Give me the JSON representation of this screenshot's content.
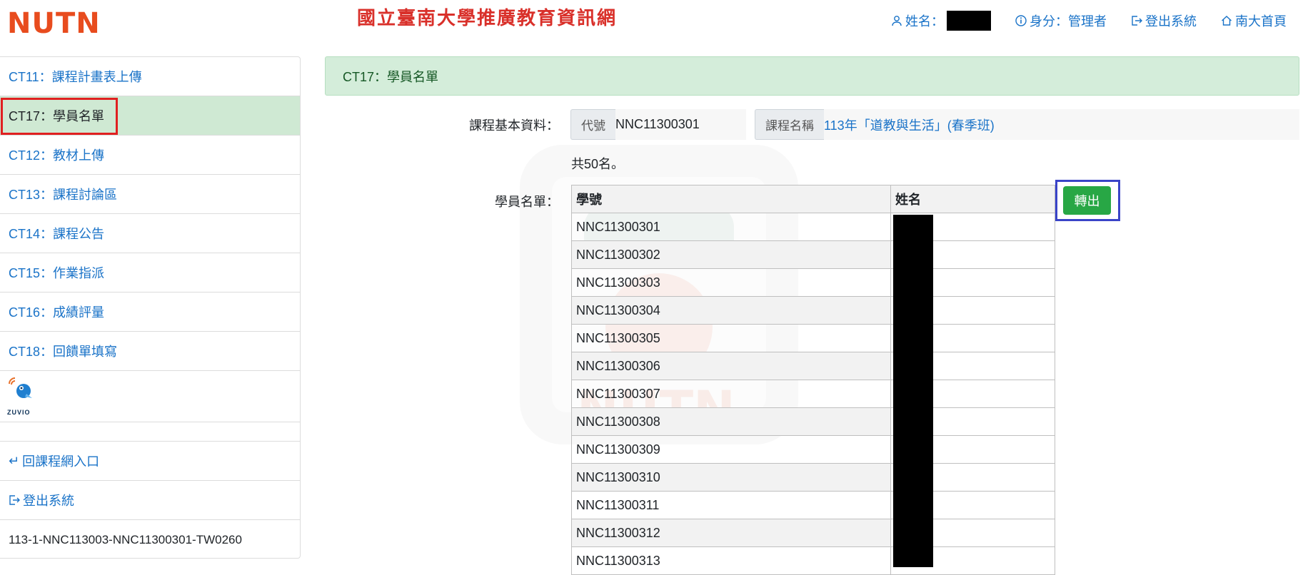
{
  "header": {
    "logo": "NUTN",
    "site_title": "國立臺南大學推廣教育資訊網",
    "user_label": "姓名：",
    "role_label": "身分：管理者",
    "logout_label": "登出系統",
    "home_label": "南大首頁"
  },
  "sidebar": {
    "items": [
      {
        "label": "CT11：課程計畫表上傳"
      },
      {
        "label": "CT17：學員名單"
      },
      {
        "label": "CT12：教材上傳"
      },
      {
        "label": "CT13：課程討論區"
      },
      {
        "label": "CT14：課程公告"
      },
      {
        "label": "CT15：作業指派"
      },
      {
        "label": "CT16：成績評量"
      },
      {
        "label": "CT18：回饋單填寫"
      }
    ],
    "zuvio_text": "ZUVIO",
    "back_label": "回課程網入口",
    "logout_label": "登出系統",
    "course_code": "113-1-NNC113003-NNC11300301-TW0260"
  },
  "main": {
    "alert_title": "CT17：學員名單",
    "basic_info_label": "課程基本資料：",
    "code_prefix": "代號",
    "code_value": "NNC11300301",
    "name_prefix": "課程名稱",
    "name_value": "113年「道教與生活」(春季班)",
    "total_text": "共50名。",
    "roster_label": "學員名單：",
    "export_label": "轉出",
    "table": {
      "headers": [
        "學號",
        "姓名"
      ],
      "rows": [
        "NNC11300301",
        "NNC11300302",
        "NNC11300303",
        "NNC11300304",
        "NNC11300305",
        "NNC11300306",
        "NNC11300307",
        "NNC11300308",
        "NNC11300309",
        "NNC11300310",
        "NNC11300311",
        "NNC11300312",
        "NNC11300313"
      ]
    }
  },
  "colors": {
    "accent_blue": "#1a73c8",
    "active_bg": "#cfe9d3",
    "alert_bg": "#d4edda",
    "export_green": "#28a745",
    "highlight_red": "#e02020",
    "highlight_blue": "#3a44c8"
  }
}
